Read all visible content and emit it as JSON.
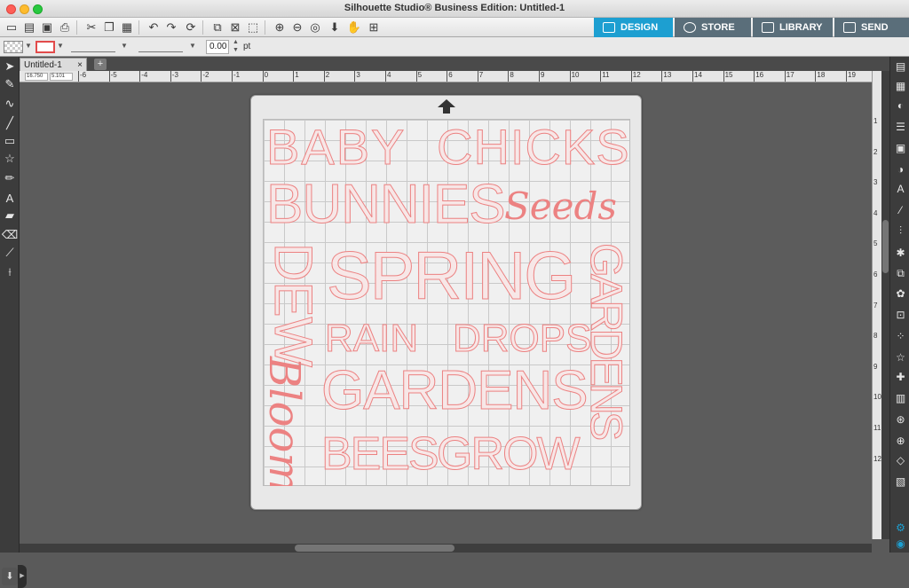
{
  "window": {
    "title": "Silhouette Studio® Business Edition: Untitled-1"
  },
  "toolbar": {
    "icons": [
      "new-document-icon",
      "open-folder-icon",
      "save-icon",
      "print-icon",
      "cut-icon",
      "copy-icon",
      "paste-icon",
      "undo-icon",
      "redo-icon",
      "refresh-icon",
      "group-icon",
      "ungroup-icon",
      "select-all-icon",
      "zoom-in-icon",
      "zoom-out-icon",
      "zoom-fit-icon",
      "move-down-icon",
      "pan-hand-icon",
      "fit-page-icon"
    ]
  },
  "nav": {
    "design": "DESIGN",
    "store": "STORE",
    "library": "LIBRARY",
    "send": "SEND",
    "active": "design"
  },
  "options": {
    "line_width_value": "0.00",
    "unit": "pt",
    "line_color": "#e24b4b"
  },
  "tabs": [
    {
      "label": "Untitled-1",
      "close": "×"
    }
  ],
  "add_tab": "+",
  "ruler": {
    "h_labels": [
      "-6",
      "-5",
      "-4",
      "-3",
      "-2",
      "-1",
      "0",
      "1",
      "2",
      "3",
      "4",
      "5",
      "6",
      "7",
      "8",
      "9",
      "10",
      "11",
      "12",
      "13",
      "14",
      "15",
      "16",
      "17",
      "18",
      "19"
    ],
    "v_labels": [
      "1",
      "2",
      "3",
      "4",
      "5",
      "6",
      "7",
      "8",
      "9",
      "10",
      "11",
      "12"
    ],
    "x_readout": "16.750",
    "y_readout": "5.101"
  },
  "design_words": {
    "w1": "BABY",
    "w2": "CHICKS",
    "w3": "BUNNIES",
    "w4": "Seeds",
    "w5": "DEW",
    "w6": "SPRING",
    "w7": "GARDENS",
    "w8": "RAIN",
    "w9": "DROPS",
    "w10": "GARDENS",
    "w11": "Bloom",
    "w12": "BEES",
    "w13": "GROW"
  },
  "colors": {
    "accent": "#1d9fd1",
    "cut_line": "#ec8282",
    "toolbar_dark": "#3c3c3c"
  }
}
